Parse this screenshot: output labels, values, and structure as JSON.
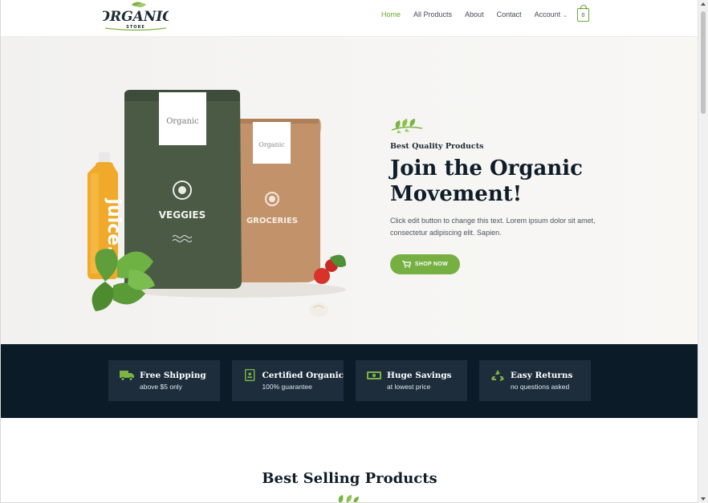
{
  "logo": {
    "word": "ORGANIC",
    "tagline": "STORE"
  },
  "nav": {
    "items": [
      {
        "label": "Home",
        "active": true
      },
      {
        "label": "All Products",
        "active": false
      },
      {
        "label": "About",
        "active": false
      },
      {
        "label": "Contact",
        "active": false
      },
      {
        "label": "Account",
        "active": false,
        "has_dropdown": true
      }
    ],
    "cart_count": "0"
  },
  "hero": {
    "eyebrow": "Best Quality Products",
    "title": "Join the Organic Movement!",
    "text": "Click edit button to change this text. Lorem ipsum dolor sit amet, consectetur adipiscing elit. Sapien.",
    "button_label": "SHOP NOW",
    "packaging": {
      "bag1_brand": "Organic",
      "bag1_label": "VEGGIES",
      "bag2_brand": "Organic",
      "bag2_label": "GROCERIES",
      "bottle_label": "juice."
    }
  },
  "features": [
    {
      "icon": "truck-icon",
      "title": "Free Shipping",
      "subtitle": "above $5 only"
    },
    {
      "icon": "certificate-icon",
      "title": "Certified Organic",
      "subtitle": "100% guarantee"
    },
    {
      "icon": "money-icon",
      "title": "Huge Savings",
      "subtitle": "at lowest price"
    },
    {
      "icon": "recycle-icon",
      "title": "Easy Returns",
      "subtitle": "no questions asked"
    }
  ],
  "best_selling": {
    "title": "Best Selling Products"
  },
  "colors": {
    "accent_green": "#6ba832",
    "button_green": "#76b043",
    "navy": "#0c1b28",
    "feature_box": "#1d2d3c",
    "bag_green": "#4a5a45",
    "bag_kraft": "#c2936b"
  }
}
